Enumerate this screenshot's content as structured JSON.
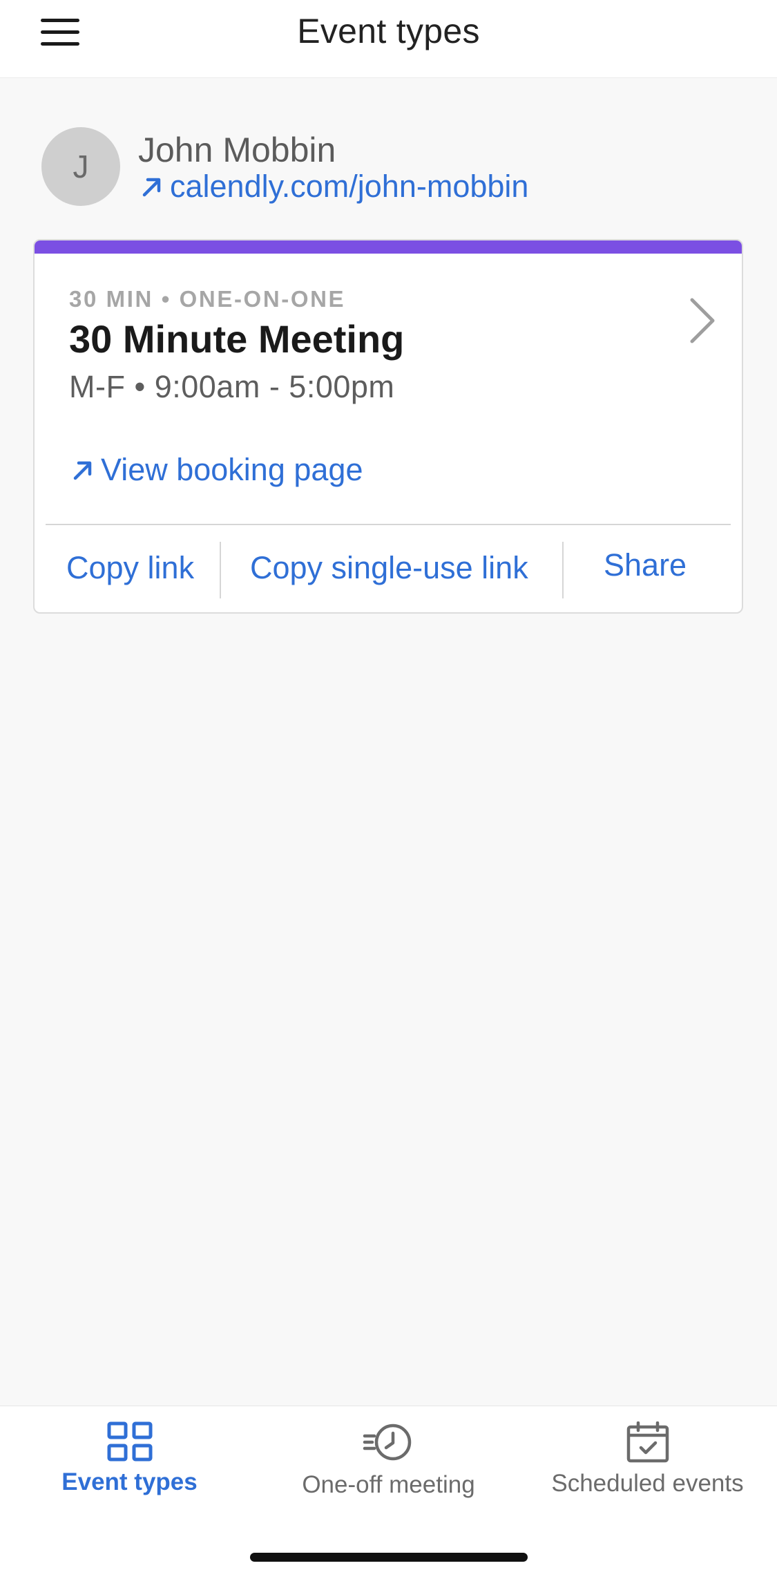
{
  "header": {
    "title": "Event types",
    "menu_icon": "hamburger-menu-icon"
  },
  "profile": {
    "avatar_initial": "J",
    "name": "John Mobbin",
    "link": "calendly.com/john-mobbin"
  },
  "event_card": {
    "accent_color": "#7b4fe3",
    "meta": "30 MIN • ONE-ON-ONE",
    "title": "30 Minute Meeting",
    "hours": "M-F • 9:00am - 5:00pm",
    "view_booking_label": "View booking page",
    "actions": {
      "copy_link": "Copy link",
      "copy_single_use_link": "Copy single-use link",
      "share": "Share"
    }
  },
  "tabbar": {
    "tabs": [
      {
        "label": "Event types",
        "icon": "grid-icon",
        "active": true
      },
      {
        "label": "One-off meeting",
        "icon": "clock-history-icon",
        "active": false
      },
      {
        "label": "Scheduled events",
        "icon": "calendar-check-icon",
        "active": false
      }
    ]
  },
  "colors": {
    "link": "#2f6fd6",
    "active_tab": "#2f6fd6",
    "accent": "#7b4fe3"
  }
}
